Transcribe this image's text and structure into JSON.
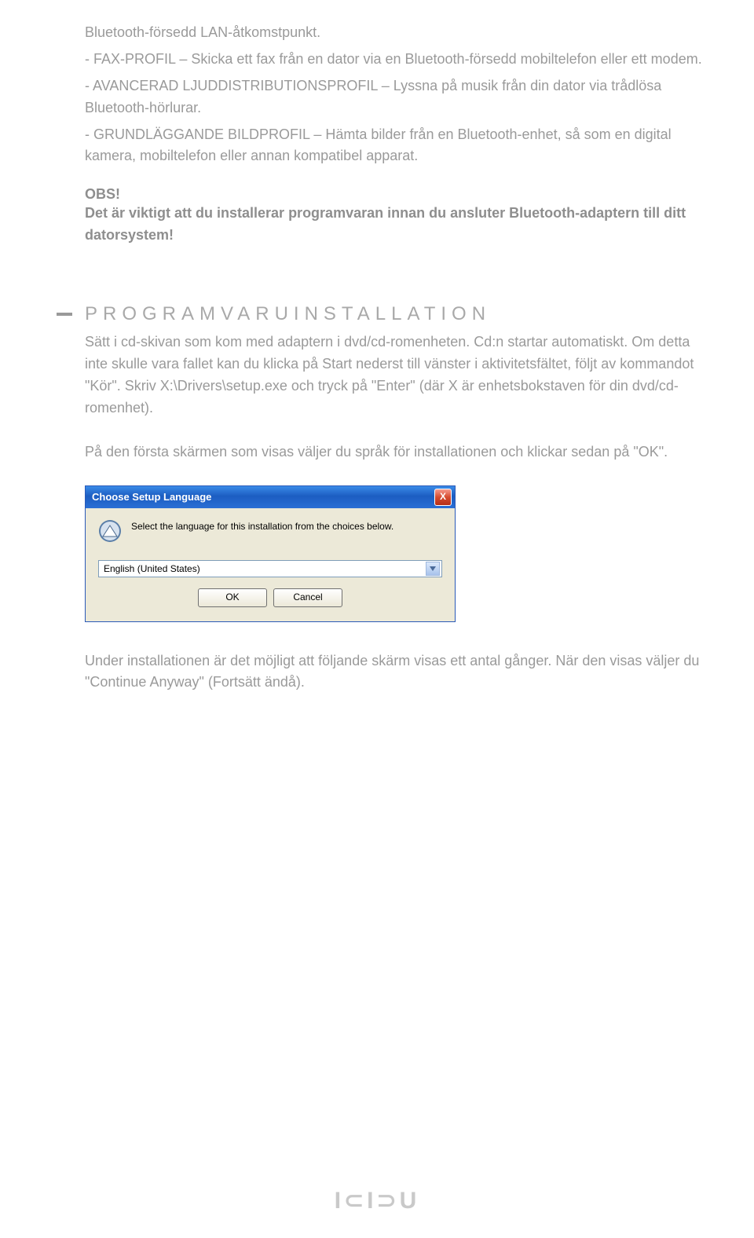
{
  "intro": {
    "line1": "Bluetooth-försedd LAN-åtkomstpunkt.",
    "fax": "- FAX-PROFIL – Skicka ett fax från en dator via en Bluetooth-försedd mobiltelefon eller ett modem.",
    "audio": "- AVANCERAD LJUDDISTRIBUTIONSPROFIL – Lyssna på musik från din dator via trådlösa Bluetooth-hörlurar.",
    "image": "- GRUNDLÄGGANDE BILDPROFIL – Hämta bilder från en Bluetooth-enhet, så som en digital kamera, mobiltelefon eller annan kompatibel apparat."
  },
  "obs": {
    "head": "OBS!",
    "body": "Det är viktigt att du installerar programvaran innan du ansluter Bluetooth-adaptern till ditt datorsystem!"
  },
  "section": {
    "heading": "PROGRAMVARUINSTALLATION",
    "p1": "Sätt i cd-skivan som kom med adaptern i dvd/cd-romenheten. Cd:n startar automatiskt. Om detta inte skulle vara fallet kan du klicka på Start nederst till vänster i aktivitetsfältet, följt av kommandot \"Kör\". Skriv X:\\Drivers\\setup.exe och tryck på \"Enter\" (där X är enhetsbokstaven för din dvd/cd-romenhet).",
    "p2": "På den första skärmen som visas väljer du språk för installationen och klickar sedan på \"OK\".",
    "p3": "Under installationen är det möjligt att följande skärm visas ett antal gånger. När den visas väljer du \"Continue Anyway\" (Fortsätt ändå)."
  },
  "dialog": {
    "title": "Choose Setup Language",
    "message": "Select the language for this installation from the choices below.",
    "selected": "English (United States)",
    "ok": "OK",
    "cancel": "Cancel",
    "close_glyph": "X"
  },
  "footer": {
    "brand": "I⊂I⊃U"
  }
}
